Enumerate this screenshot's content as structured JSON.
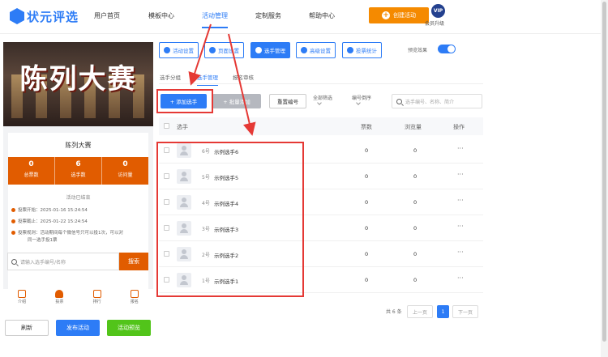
{
  "topbar": {
    "logo_text": "状元评选",
    "nav": [
      {
        "label": "用户首页"
      },
      {
        "label": "模板中心"
      },
      {
        "label": "活动管理"
      },
      {
        "label": "定制服务"
      },
      {
        "label": "帮助中心"
      }
    ],
    "create_label": "创建活动",
    "vip_badge": "VIP",
    "vip_label": "会员升级"
  },
  "preview": {
    "banner_title": "陈列大赛",
    "card_title": "陈列大赛",
    "stats": [
      {
        "value": "0",
        "label": "总票数"
      },
      {
        "value": "6",
        "label": "选手数"
      },
      {
        "value": "0",
        "label": "访问量"
      }
    ],
    "status": "活动已结束",
    "vote_start": "投票开始：2025-01-16 15:24:54",
    "vote_end": "投票截止：2025-01-22 15:24:54",
    "rule_line1": "投票规则：活动期间每个微信号只可以投1次，可以对",
    "rule_line2": "同一选手投1票",
    "search_placeholder": "请输入选手编号/名称",
    "search_label": "搜索",
    "tabs": [
      {
        "label": "介绍"
      },
      {
        "label": "投票"
      },
      {
        "label": "排行"
      },
      {
        "label": "报名"
      }
    ],
    "refresh_label": "刷新",
    "publish_label": "发布活动",
    "preview_label": "活动预览"
  },
  "toolbar": {
    "buttons": [
      {
        "label": "活动设置"
      },
      {
        "label": "页面设置"
      },
      {
        "label": "选手管理"
      },
      {
        "label": "高级设置"
      },
      {
        "label": "投票统计"
      }
    ],
    "preview_effect": "预览效果"
  },
  "subtabs": [
    {
      "label": "选手分组"
    },
    {
      "label": "选手管理"
    },
    {
      "label": "报名审核"
    }
  ],
  "actions": {
    "add_label": "+ 添加选手",
    "batch_label": "+ 批量添加",
    "renumber_label": "重置编号",
    "group_filter": "全部筛选",
    "sort_filter": "编号倒序",
    "search_placeholder": "选手编号、名称、简介"
  },
  "table": {
    "headers": {
      "player": "选手",
      "votes": "票数",
      "views": "浏览量",
      "ops": "操作"
    },
    "rows": [
      {
        "number": "6号",
        "name": "示例选手6",
        "votes": "0",
        "views": "0",
        "more": "···"
      },
      {
        "number": "5号",
        "name": "示例选手5",
        "votes": "0",
        "views": "0",
        "more": "···"
      },
      {
        "number": "4号",
        "name": "示例选手4",
        "votes": "0",
        "views": "0",
        "more": "···"
      },
      {
        "number": "3号",
        "name": "示例选手3",
        "votes": "0",
        "views": "0",
        "more": "···"
      },
      {
        "number": "2号",
        "name": "示例选手2",
        "votes": "0",
        "views": "0",
        "more": "···"
      },
      {
        "number": "1号",
        "name": "示例选手1",
        "votes": "0",
        "views": "0",
        "more": "···"
      }
    ]
  },
  "pager": {
    "total": "共 6 条",
    "prev": "上一页",
    "current": "1",
    "next": "下一页"
  },
  "colors": {
    "primary": "#2d7cf6",
    "orange": "#f58a00",
    "accent_orange": "#e15c00",
    "green": "#52c41a",
    "annotation_red": "#e53935"
  }
}
